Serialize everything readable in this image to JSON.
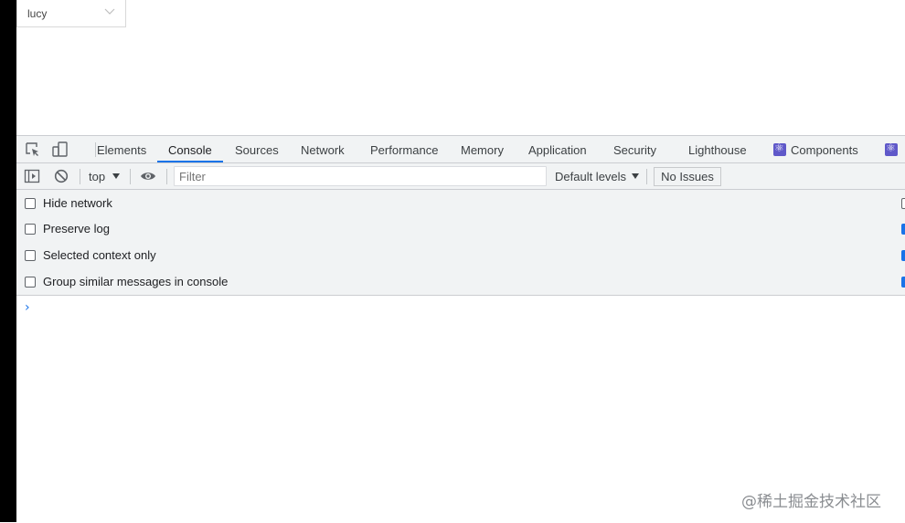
{
  "page": {
    "select_value": "lucy"
  },
  "devtools": {
    "tabs": [
      "Elements",
      "Console",
      "Sources",
      "Network",
      "Performance",
      "Memory",
      "Application",
      "Security",
      "Lighthouse",
      "Components"
    ],
    "active_tab": "Console",
    "toolbar": {
      "context": "top",
      "filter_placeholder": "Filter",
      "levels": "Default levels",
      "issues": "No Issues"
    },
    "settings": {
      "options": [
        "Hide network",
        "Preserve log",
        "Selected context only",
        "Group similar messages in console"
      ]
    },
    "console": {
      "prompt": "›"
    }
  },
  "watermark": "@稀土掘金技术社区",
  "colors": {
    "accent": "#1a73e8",
    "toolbar_bg": "#f1f3f4",
    "extension_icon": "#5f58c9"
  }
}
